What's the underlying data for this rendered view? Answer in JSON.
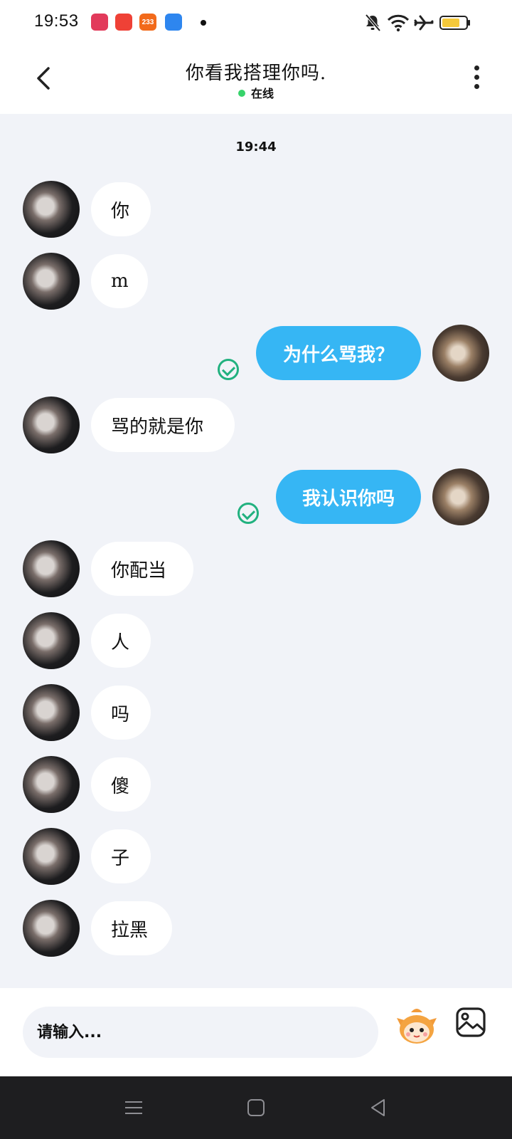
{
  "status_bar": {
    "time": "19:53",
    "app_icons": [
      {
        "name": "video-app-icon",
        "color": "#e23a5b",
        "text": ""
      },
      {
        "name": "play-app-icon",
        "color": "#ef4136",
        "text": ""
      },
      {
        "name": "233-app-icon",
        "color": "#f26a1b",
        "text": "233"
      },
      {
        "name": "cloud-app-icon",
        "color": "#2e86ef",
        "text": ""
      }
    ]
  },
  "header": {
    "title": "你看我搭理你吗.",
    "status": "在线"
  },
  "chat": {
    "timestamp": "19:44",
    "messages": [
      {
        "side": "left",
        "text": "你",
        "checked": false
      },
      {
        "side": "left",
        "text": "m",
        "checked": false
      },
      {
        "side": "right",
        "text": "为什么骂我？",
        "checked": true
      },
      {
        "side": "left",
        "text": "骂的就是你",
        "checked": false
      },
      {
        "side": "right",
        "text": "我认识你吗",
        "checked": true
      },
      {
        "side": "left",
        "text": "你配当",
        "checked": false
      },
      {
        "side": "left",
        "text": "人",
        "checked": false
      },
      {
        "side": "left",
        "text": "吗",
        "checked": false
      },
      {
        "side": "left",
        "text": "傻",
        "checked": false
      },
      {
        "side": "left",
        "text": "子",
        "checked": false
      },
      {
        "side": "left",
        "text": "拉黑",
        "checked": false
      }
    ]
  },
  "input": {
    "placeholder": "请输入..."
  },
  "colors": {
    "sent_bubble": "#36b6f4",
    "received_bubble": "#ffffff",
    "chat_background": "#f1f3f8",
    "check": "#21b17f",
    "online_dot": "#37d36b"
  }
}
